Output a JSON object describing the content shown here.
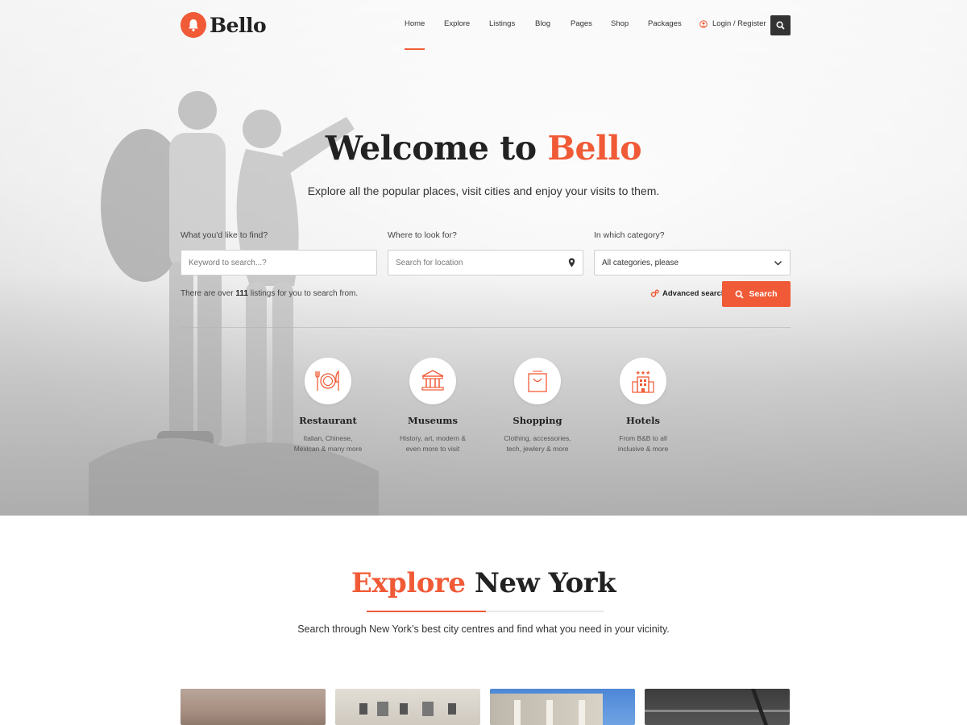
{
  "brand": {
    "name": "Bello",
    "accent_color": "#f05a36"
  },
  "nav": {
    "items": [
      "Home",
      "Explore",
      "Listings",
      "Blog",
      "Pages",
      "Shop",
      "Packages"
    ],
    "active": "Home",
    "login_label": "Login / Register"
  },
  "hero": {
    "title_prefix": "Welcome to",
    "title_accent": "Bello",
    "subtitle": "Explore all the popular places, visit cities and enjoy your visits to them."
  },
  "search": {
    "find_label": "What you'd like to find?",
    "find_placeholder": "Keyword to search...?",
    "where_label": "Where to look for?",
    "where_placeholder": "Search for location",
    "category_label": "In which category?",
    "category_value": "All categories, please",
    "count_prefix": "There are over",
    "count_value": "111",
    "count_suffix": "listings for you to search from.",
    "advanced_label": "Advanced search",
    "button_label": "Search"
  },
  "categories": [
    {
      "name": "Restaurant",
      "desc": "Italian, Chinese, Mexican & many more",
      "icon": "plate-cutlery-icon"
    },
    {
      "name": "Museums",
      "desc": "History, art, modern & even more to visit",
      "icon": "museum-icon"
    },
    {
      "name": "Shopping",
      "desc": "Clothing, accessories, tech, jewlery & more",
      "icon": "shopping-bag-icon"
    },
    {
      "name": "Hotels",
      "desc": "From B&B to all inclusive & more",
      "icon": "hotel-icon"
    }
  ],
  "explore": {
    "title_accent": "Explore",
    "title_rest": "New York",
    "subtitle": "Search through New York’s best city centres and find what you need in your vicinity."
  }
}
